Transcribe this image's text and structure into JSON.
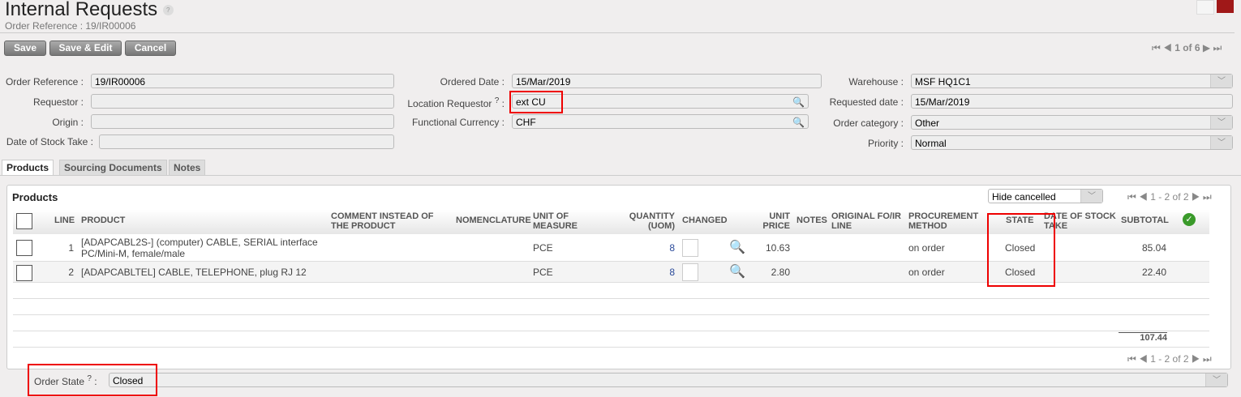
{
  "header": {
    "title": "Internal Requests",
    "subtitle": "Order Reference : 19/IR00006",
    "help": "?"
  },
  "toolbar": {
    "save": "Save",
    "save_edit": "Save & Edit",
    "cancel": "Cancel",
    "pager": "1 of 6"
  },
  "form": {
    "order_reference_label": "Order Reference :",
    "order_reference": "19/IR00006",
    "requestor_label": "Requestor :",
    "origin_label": "Origin :",
    "stock_take_label": "Date of Stock Take :",
    "ordered_date_label": "Ordered Date :",
    "ordered_date": "15/Mar/2019",
    "location_requestor_label": "Location Requestor",
    "location_requestor": "ext CU",
    "currency_label": "Functional Currency :",
    "currency": "CHF",
    "warehouse_label": "Warehouse :",
    "warehouse": "MSF HQ1C1",
    "requested_date_label": "Requested date :",
    "requested_date": "15/Mar/2019",
    "order_category_label": "Order category :",
    "order_category": "Other",
    "priority_label": "Priority :",
    "priority": "Normal"
  },
  "tabs": [
    "Products",
    "Sourcing Documents",
    "Notes"
  ],
  "products": {
    "title": "Products",
    "filter": "Hide cancelled",
    "pager": "1 - 2 of 2",
    "total": "107.44",
    "columns": [
      "LINE",
      "PRODUCT",
      "COMMENT INSTEAD OF THE PRODUCT",
      "NOMENCLATURE",
      "UNIT OF MEASURE",
      "QUANTITY (UOM)",
      "CHANGED",
      "UNIT PRICE",
      "NOTES",
      "ORIGINAL FO/IR LINE",
      "PROCUREMENT METHOD",
      "STATE",
      "DATE OF STOCK TAKE",
      "SUBTOTAL"
    ],
    "rows": [
      {
        "line": "1",
        "product": "[ADAPCABL2S-] (computer) CABLE, SERIAL interface PC/Mini-M, female/male",
        "uom": "PCE",
        "qty": "8",
        "price": "10.63",
        "method": "on order",
        "state": "Closed",
        "subtotal": "85.04"
      },
      {
        "line": "2",
        "product": "[ADAPCABLTEL] CABLE, TELEPHONE, plug RJ 12",
        "uom": "PCE",
        "qty": "8",
        "price": "2.80",
        "method": "on order",
        "state": "Closed",
        "subtotal": "22.40"
      }
    ]
  },
  "footer": {
    "order_state_label": "Order State",
    "order_state": "Closed"
  }
}
